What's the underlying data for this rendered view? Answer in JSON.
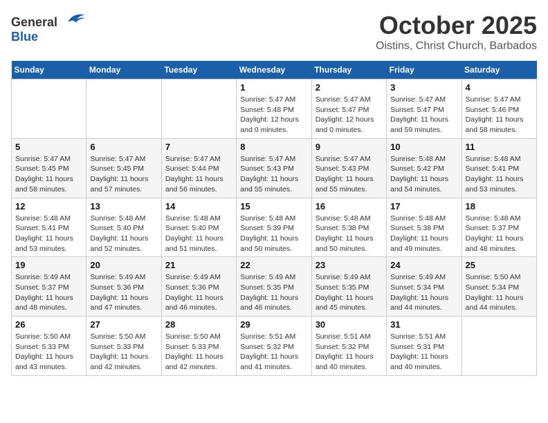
{
  "logo": {
    "general": "General",
    "blue": "Blue"
  },
  "title": "October 2025",
  "location": "Oistins, Christ Church, Barbados",
  "days_of_week": [
    "Sunday",
    "Monday",
    "Tuesday",
    "Wednesday",
    "Thursday",
    "Friday",
    "Saturday"
  ],
  "weeks": [
    [
      {
        "day": "",
        "info": ""
      },
      {
        "day": "",
        "info": ""
      },
      {
        "day": "",
        "info": ""
      },
      {
        "day": "1",
        "info": "Sunrise: 5:47 AM\nSunset: 5:48 PM\nDaylight: 12 hours\nand 0 minutes."
      },
      {
        "day": "2",
        "info": "Sunrise: 5:47 AM\nSunset: 5:47 PM\nDaylight: 12 hours\nand 0 minutes."
      },
      {
        "day": "3",
        "info": "Sunrise: 5:47 AM\nSunset: 5:47 PM\nDaylight: 11 hours\nand 59 minutes."
      },
      {
        "day": "4",
        "info": "Sunrise: 5:47 AM\nSunset: 5:46 PM\nDaylight: 11 hours\nand 58 minutes."
      }
    ],
    [
      {
        "day": "5",
        "info": "Sunrise: 5:47 AM\nSunset: 5:45 PM\nDaylight: 11 hours\nand 58 minutes."
      },
      {
        "day": "6",
        "info": "Sunrise: 5:47 AM\nSunset: 5:45 PM\nDaylight: 11 hours\nand 57 minutes."
      },
      {
        "day": "7",
        "info": "Sunrise: 5:47 AM\nSunset: 5:44 PM\nDaylight: 11 hours\nand 56 minutes."
      },
      {
        "day": "8",
        "info": "Sunrise: 5:47 AM\nSunset: 5:43 PM\nDaylight: 11 hours\nand 55 minutes."
      },
      {
        "day": "9",
        "info": "Sunrise: 5:47 AM\nSunset: 5:43 PM\nDaylight: 11 hours\nand 55 minutes."
      },
      {
        "day": "10",
        "info": "Sunrise: 5:48 AM\nSunset: 5:42 PM\nDaylight: 11 hours\nand 54 minutes."
      },
      {
        "day": "11",
        "info": "Sunrise: 5:48 AM\nSunset: 5:41 PM\nDaylight: 11 hours\nand 53 minutes."
      }
    ],
    [
      {
        "day": "12",
        "info": "Sunrise: 5:48 AM\nSunset: 5:41 PM\nDaylight: 11 hours\nand 53 minutes."
      },
      {
        "day": "13",
        "info": "Sunrise: 5:48 AM\nSunset: 5:40 PM\nDaylight: 11 hours\nand 52 minutes."
      },
      {
        "day": "14",
        "info": "Sunrise: 5:48 AM\nSunset: 5:40 PM\nDaylight: 11 hours\nand 51 minutes."
      },
      {
        "day": "15",
        "info": "Sunrise: 5:48 AM\nSunset: 5:39 PM\nDaylight: 11 hours\nand 50 minutes."
      },
      {
        "day": "16",
        "info": "Sunrise: 5:48 AM\nSunset: 5:38 PM\nDaylight: 11 hours\nand 50 minutes."
      },
      {
        "day": "17",
        "info": "Sunrise: 5:48 AM\nSunset: 5:38 PM\nDaylight: 11 hours\nand 49 minutes."
      },
      {
        "day": "18",
        "info": "Sunrise: 5:48 AM\nSunset: 5:37 PM\nDaylight: 11 hours\nand 48 minutes."
      }
    ],
    [
      {
        "day": "19",
        "info": "Sunrise: 5:49 AM\nSunset: 5:37 PM\nDaylight: 11 hours\nand 48 minutes."
      },
      {
        "day": "20",
        "info": "Sunrise: 5:49 AM\nSunset: 5:36 PM\nDaylight: 11 hours\nand 47 minutes."
      },
      {
        "day": "21",
        "info": "Sunrise: 5:49 AM\nSunset: 5:36 PM\nDaylight: 11 hours\nand 46 minutes."
      },
      {
        "day": "22",
        "info": "Sunrise: 5:49 AM\nSunset: 5:35 PM\nDaylight: 11 hours\nand 46 minutes."
      },
      {
        "day": "23",
        "info": "Sunrise: 5:49 AM\nSunset: 5:35 PM\nDaylight: 11 hours\nand 45 minutes."
      },
      {
        "day": "24",
        "info": "Sunrise: 5:49 AM\nSunset: 5:34 PM\nDaylight: 11 hours\nand 44 minutes."
      },
      {
        "day": "25",
        "info": "Sunrise: 5:50 AM\nSunset: 5:34 PM\nDaylight: 11 hours\nand 44 minutes."
      }
    ],
    [
      {
        "day": "26",
        "info": "Sunrise: 5:50 AM\nSunset: 5:33 PM\nDaylight: 11 hours\nand 43 minutes."
      },
      {
        "day": "27",
        "info": "Sunrise: 5:50 AM\nSunset: 5:33 PM\nDaylight: 11 hours\nand 42 minutes."
      },
      {
        "day": "28",
        "info": "Sunrise: 5:50 AM\nSunset: 5:33 PM\nDaylight: 11 hours\nand 42 minutes."
      },
      {
        "day": "29",
        "info": "Sunrise: 5:51 AM\nSunset: 5:32 PM\nDaylight: 11 hours\nand 41 minutes."
      },
      {
        "day": "30",
        "info": "Sunrise: 5:51 AM\nSunset: 5:32 PM\nDaylight: 11 hours\nand 40 minutes."
      },
      {
        "day": "31",
        "info": "Sunrise: 5:51 AM\nSunset: 5:31 PM\nDaylight: 11 hours\nand 40 minutes."
      },
      {
        "day": "",
        "info": ""
      }
    ]
  ]
}
